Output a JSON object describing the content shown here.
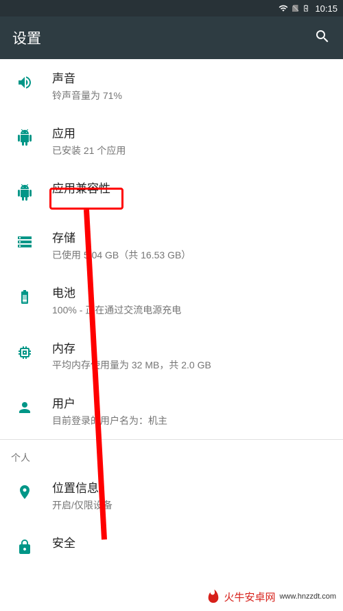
{
  "status": {
    "time": "10:15"
  },
  "appbar": {
    "title": "设置"
  },
  "items": [
    {
      "icon": "volume",
      "title": "声音",
      "sub": "铃声音量为 71%"
    },
    {
      "icon": "android",
      "title": "应用",
      "sub": "已安装 21 个应用"
    },
    {
      "icon": "android",
      "title": "应用兼容性",
      "sub": ""
    },
    {
      "icon": "storage",
      "title": "存储",
      "sub": "已使用 5.04 GB（共 16.53 GB）"
    },
    {
      "icon": "battery",
      "title": "电池",
      "sub": "100% - 正在通过交流电源充电"
    },
    {
      "icon": "memory",
      "title": "内存",
      "sub": "平均内存使用量为 32 MB，共 2.0 GB"
    },
    {
      "icon": "person",
      "title": "用户",
      "sub": "目前登录的用户名为：机主"
    }
  ],
  "section": {
    "header": "个人"
  },
  "items2": [
    {
      "icon": "location",
      "title": "位置信息",
      "sub": "开启/仅限设备"
    },
    {
      "icon": "lock",
      "title": "安全",
      "sub": ""
    }
  ],
  "watermark": {
    "brand": "火牛安卓网",
    "url": "www.hnzzdt.com"
  }
}
